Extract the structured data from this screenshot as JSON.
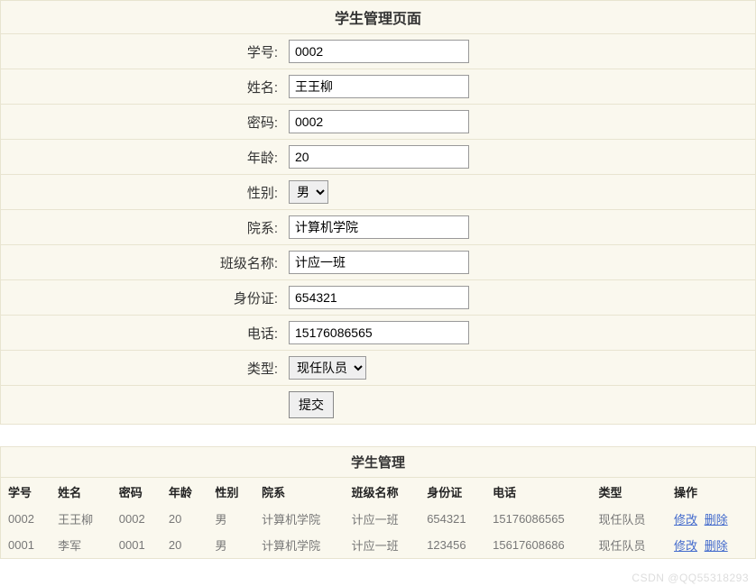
{
  "page_title": "学生管理页面",
  "form": {
    "fields": [
      {
        "label": "学号:",
        "value": "0002",
        "type": "text"
      },
      {
        "label": "姓名:",
        "value": "王王柳",
        "type": "text"
      },
      {
        "label": "密码:",
        "value": "0002",
        "type": "text"
      },
      {
        "label": "年龄:",
        "value": "20",
        "type": "text"
      },
      {
        "label": "性别:",
        "value": "男",
        "type": "select"
      },
      {
        "label": "院系:",
        "value": "计算机学院",
        "type": "text"
      },
      {
        "label": "班级名称:",
        "value": "计应一班",
        "type": "text"
      },
      {
        "label": "身份证:",
        "value": "654321",
        "type": "text"
      },
      {
        "label": "电话:",
        "value": "15176086565",
        "type": "text"
      },
      {
        "label": "类型:",
        "value": "现任队员",
        "type": "select"
      }
    ],
    "submit_label": "提交"
  },
  "table": {
    "title": "学生管理",
    "headers": [
      "学号",
      "姓名",
      "密码",
      "年龄",
      "性别",
      "院系",
      "班级名称",
      "身份证",
      "电话",
      "类型",
      "操作"
    ],
    "rows": [
      {
        "cells": [
          "0002",
          "王王柳",
          "0002",
          "20",
          "男",
          "计算机学院",
          "计应一班",
          "654321",
          "15176086565",
          "现任队员"
        ],
        "actions": [
          "修改",
          "删除"
        ]
      },
      {
        "cells": [
          "0001",
          "李军",
          "0001",
          "20",
          "男",
          "计算机学院",
          "计应一班",
          "123456",
          "15617608686",
          "现任队员"
        ],
        "actions": [
          "修改",
          "删除"
        ]
      }
    ]
  },
  "watermark": "CSDN @QQ55318293"
}
